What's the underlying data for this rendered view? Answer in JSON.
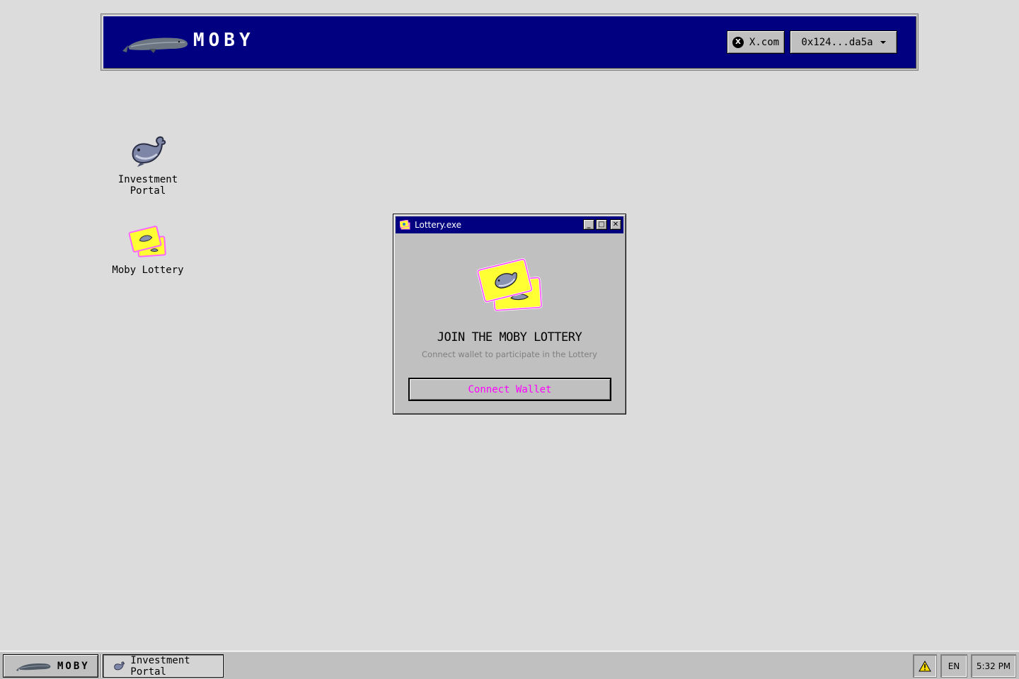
{
  "header": {
    "brand": "MOBY",
    "x_link_label": "X.com",
    "wallet_label": "0x124...da5a"
  },
  "desktop": {
    "icons": [
      {
        "label": "Investment Portal",
        "icon": "whale-icon"
      },
      {
        "label": "Moby Lottery",
        "icon": "lottery-tickets-icon"
      }
    ]
  },
  "window": {
    "title": "Lottery.exe",
    "heading": "JOIN THE MOBY LOTTERY",
    "subtitle": "Connect wallet to participate in the Lottery",
    "connect_label": "Connect Wallet",
    "controls": [
      "minimize",
      "maximize",
      "close"
    ]
  },
  "taskbar": {
    "start_label": "MOBY",
    "open_task": "Investment Portal",
    "language": "EN",
    "clock": "5:32 PM",
    "warning_icon": "warning-icon"
  },
  "colors": {
    "navy": "#000080",
    "desktop_bg": "#dcdcdc",
    "chrome": "#c0c0c0",
    "accent_magenta": "#ff00ff",
    "ticket_yellow": "#ffff33"
  }
}
